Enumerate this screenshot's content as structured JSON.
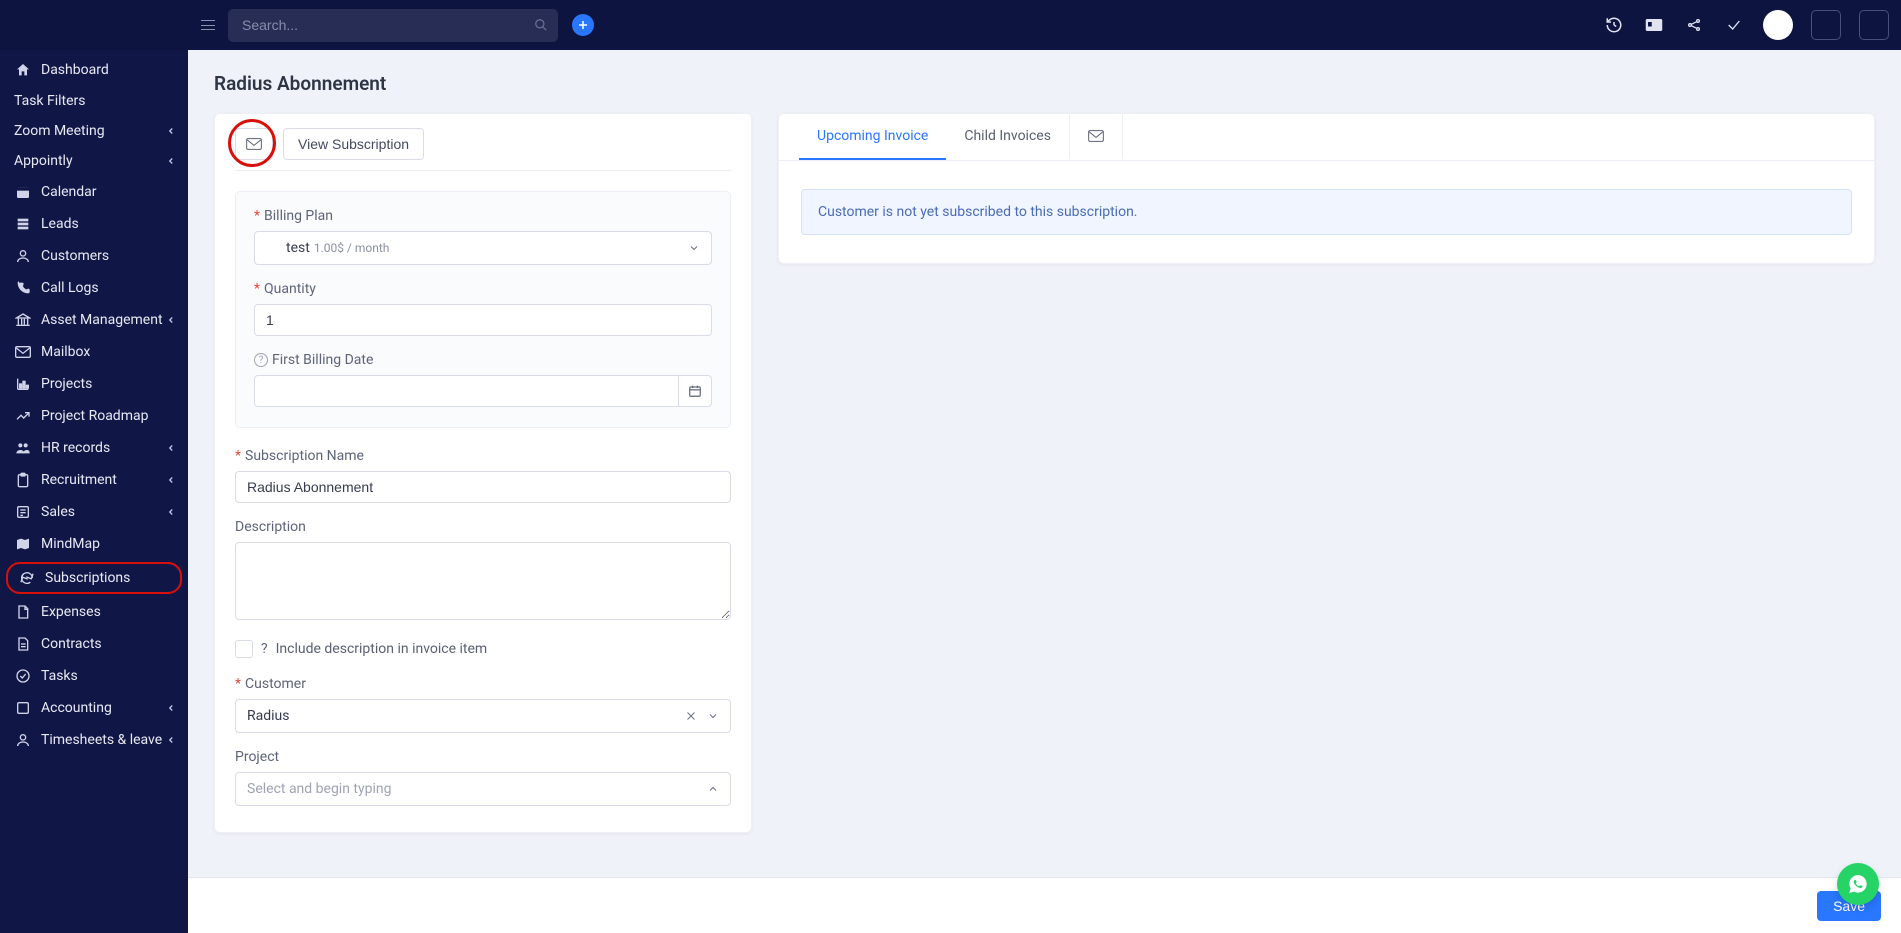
{
  "topbar": {
    "search_placeholder": "Search..."
  },
  "sidebar": {
    "items": [
      {
        "label": "Dashboard",
        "icon": "home"
      },
      {
        "label": "Task Filters",
        "icon": null
      },
      {
        "label": "Zoom Meeting",
        "icon": null,
        "chev": true
      },
      {
        "label": "Appointly",
        "icon": null,
        "chev": true
      },
      {
        "label": "Calendar",
        "icon": "calendar"
      },
      {
        "label": "Leads",
        "icon": "leads"
      },
      {
        "label": "Customers",
        "icon": "person"
      },
      {
        "label": "Call Logs",
        "icon": "phone"
      },
      {
        "label": "Asset Management",
        "icon": "bank",
        "chev": true
      },
      {
        "label": "Mailbox",
        "icon": "mail"
      },
      {
        "label": "Projects",
        "icon": "chart"
      },
      {
        "label": "Project Roadmap",
        "icon": "trend"
      },
      {
        "label": "HR records",
        "icon": "people",
        "chev": true
      },
      {
        "label": "Recruitment",
        "icon": "clipboard",
        "chev": true
      },
      {
        "label": "Sales",
        "icon": "list",
        "chev": true
      },
      {
        "label": "MindMap",
        "icon": "map"
      },
      {
        "label": "Subscriptions",
        "icon": "refresh",
        "active": true
      },
      {
        "label": "Expenses",
        "icon": "file"
      },
      {
        "label": "Contracts",
        "icon": "doc"
      },
      {
        "label": "Tasks",
        "icon": "check"
      },
      {
        "label": "Accounting",
        "icon": "dollar",
        "chev": true
      },
      {
        "label": "Timesheets & leave",
        "icon": "person2",
        "chev": true
      }
    ]
  },
  "page": {
    "title": "Radius Abonnement"
  },
  "left_card": {
    "view_subscription": "View Subscription",
    "labels": {
      "billing_plan": "Billing Plan",
      "quantity": "Quantity",
      "first_billing_date": "First Billing Date",
      "subscription_name": "Subscription Name",
      "description": "Description",
      "include_desc": "Include description in invoice item",
      "customer": "Customer",
      "project": "Project",
      "project_placeholder": "Select and begin typing"
    },
    "values": {
      "plan_name": "test",
      "plan_price": "1.00$ / month",
      "quantity": "1",
      "first_billing_date": "",
      "subscription_name": "Radius Abonnement",
      "description": "",
      "customer": "Radius"
    }
  },
  "right_card": {
    "tabs": {
      "upcoming": "Upcoming Invoice",
      "child": "Child Invoices"
    },
    "info_text": "Customer is not yet subscribed to this subscription."
  },
  "footer": {
    "save": "Save"
  }
}
